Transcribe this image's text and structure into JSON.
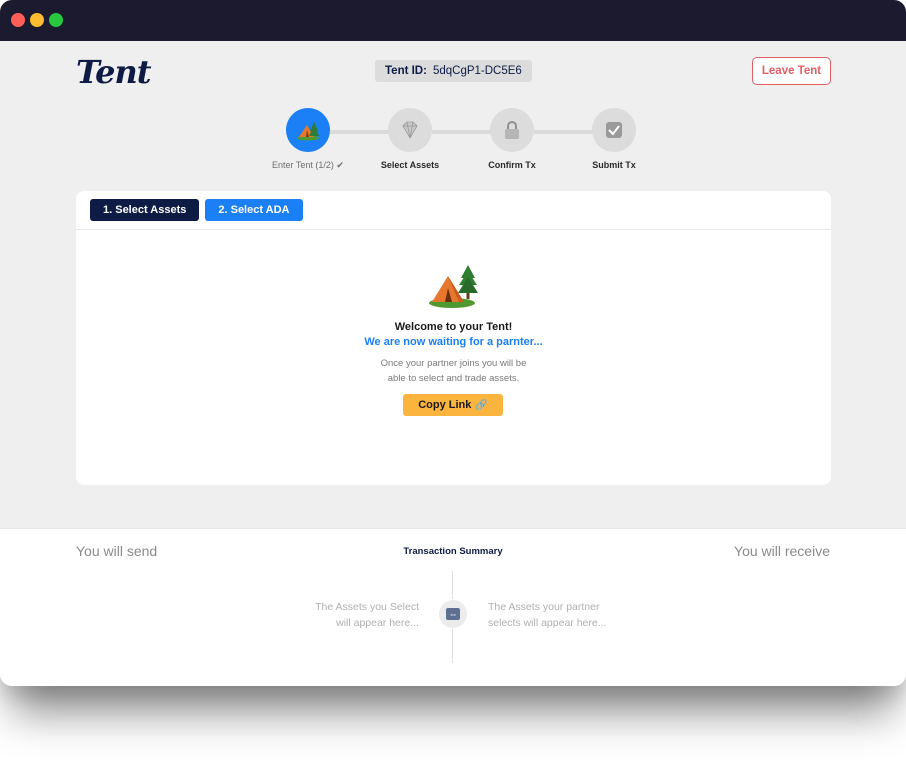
{
  "window": {
    "controls": [
      "close",
      "minimize",
      "maximize"
    ],
    "colors": {
      "titlebar": "#1b1a2e",
      "close": "#ff5f58",
      "minimize": "#ffbd2f",
      "maximize": "#28c840"
    }
  },
  "header": {
    "logo": "Tent",
    "tent_id_label": "Tent ID:",
    "tent_id_value": "5dqCgP1-DC5E6",
    "leave_label": "Leave Tent"
  },
  "stepper": {
    "steps": [
      {
        "label": "Enter Tent (1/2) ✔",
        "icon": "camping-icon",
        "state": "active"
      },
      {
        "label": "Select Assets",
        "icon": "gem-icon",
        "state": "pending"
      },
      {
        "label": "Confirm Tx",
        "icon": "lock-icon",
        "state": "pending"
      },
      {
        "label": "Submit Tx",
        "icon": "checkbox-icon",
        "state": "pending"
      }
    ]
  },
  "card": {
    "tabs": [
      {
        "label": "1. Select Assets"
      },
      {
        "label": "2. Select ADA"
      }
    ],
    "welcome_title": "Welcome to your Tent!",
    "waiting_text": "We are now waiting for a parnter...",
    "description_line1": "Once your partner joins you will be",
    "description_line2": "able to select and trade assets.",
    "copy_label": "Copy Link",
    "copy_icon": "🔗"
  },
  "summary": {
    "send_label": "You will send",
    "title": "Transaction Summary",
    "receive_label": "You will receive",
    "send_hint_line1": "The Assets you Select",
    "send_hint_line2": "will appear here...",
    "receive_hint_line1": "The Assets your partner",
    "receive_hint_line2": "selects will appear here..."
  },
  "colors": {
    "primary_blue": "#1b7ff5",
    "navy": "#0e1b45",
    "danger": "#e06065",
    "accent": "#fbb53f"
  }
}
